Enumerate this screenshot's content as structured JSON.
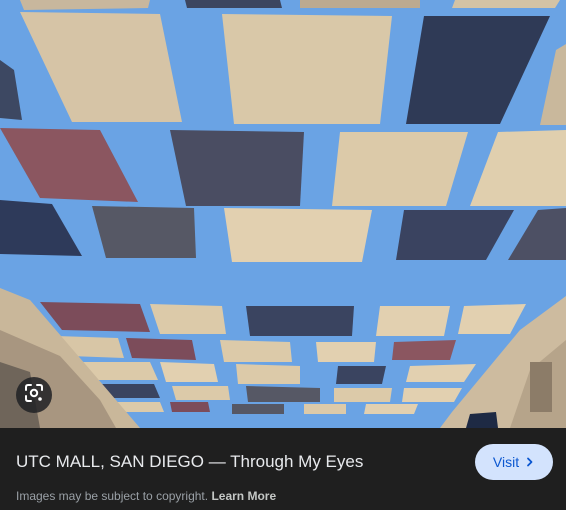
{
  "result": {
    "title": "UTC MALL, SAN DIEGO — Through My Eyes",
    "visit_label": "Visit",
    "copyright_text": "Images may be subject to copyright.",
    "learn_more_label": "Learn More"
  },
  "icons": {
    "lens": "google-lens-icon",
    "visit_chevron": "chevron-right-icon"
  },
  "colors": {
    "sky": "#6ea6e6",
    "panel_bg": "#1f1f1f",
    "visit_bg": "#d3e3fd",
    "visit_text": "#0b57d0"
  }
}
